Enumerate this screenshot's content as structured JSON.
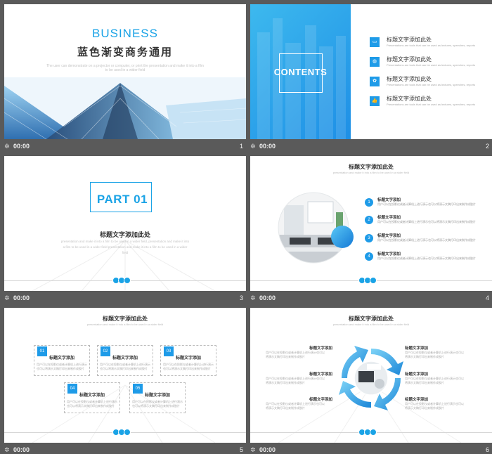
{
  "slides": [
    {
      "num": "1",
      "time": "00:00",
      "title": "BUSINESS",
      "subtitle": "蓝色渐变商务通用",
      "desc": "The user can demonstrate on a projector or computer, or print the presentation and make it into a film to be used in a wider field"
    },
    {
      "num": "2",
      "time": "00:00",
      "title": "CONTENTS",
      "items": [
        {
          "label": "标题文字添加此处",
          "small": "Presentations are tools that can be used as lectures, speeches, reports",
          "icon": "▭"
        },
        {
          "label": "标题文字添加此处",
          "small": "Presentations are tools that can be used as lectures, speeches, reports",
          "icon": "◍"
        },
        {
          "label": "标题文字添加此处",
          "small": "Presentations are tools that can be used as lectures, speeches, reports",
          "icon": "✿"
        },
        {
          "label": "标题文字添加此处",
          "small": "Presentations are tools that can be used as lectures, speeches, reports",
          "icon": "👍"
        }
      ]
    },
    {
      "num": "3",
      "time": "00:00",
      "title": "PART 01",
      "subtitle": "标题文字添加此处",
      "desc": "presentation and make it into a film to be used in a wider field, presentation and make it into a film to be used in a wider field presentation and make it into a film to be used in a wider field"
    },
    {
      "num": "4",
      "time": "00:00",
      "title": "标题文字添加此处",
      "subtitle": "presentation and make it into a film to be used in a wider field",
      "items": [
        {
          "n": "1",
          "title": "标题文字添加",
          "desc": "用户可以在投影仪或者计算机上进行演示也可以将演示文稿打印出来制作成胶片"
        },
        {
          "n": "2",
          "title": "标题文字添加",
          "desc": "用户可以在投影仪或者计算机上进行演示也可以将演示文稿打印出来制作成胶片"
        },
        {
          "n": "3",
          "title": "标题文字添加",
          "desc": "用户可以在投影仪或者计算机上进行演示也可以将演示文稿打印出来制作成胶片"
        },
        {
          "n": "4",
          "title": "标题文字添加",
          "desc": "用户可以在投影仪或者计算机上进行演示也可以将演示文稿打印出来制作成胶片"
        }
      ]
    },
    {
      "num": "5",
      "time": "00:00",
      "title": "标题文字添加此处",
      "subtitle": "presentation and make it into a film to be used in a wider field",
      "cards": [
        {
          "n": "01",
          "title": "标题文字添加",
          "desc": "用户可以在投影仪或者计算机上进行演示也可以将演示文稿打印出来制作成胶片"
        },
        {
          "n": "02",
          "title": "标题文字添加",
          "desc": "用户可以在投影仪或者计算机上进行演示也可以将演示文稿打印出来制作成胶片"
        },
        {
          "n": "03",
          "title": "标题文字添加",
          "desc": "用户可以在投影仪或者计算机上进行演示也可以将演示文稿打印出来制作成胶片"
        },
        {
          "n": "04",
          "title": "标题文字添加",
          "desc": "用户可以在投影仪或者计算机上进行演示也可以将演示文稿打印出来制作成胶片"
        },
        {
          "n": "05",
          "title": "标题文字添加",
          "desc": "用户可以在投影仪或者计算机上进行演示也可以将演示文稿打印出来制作成胶片"
        }
      ]
    },
    {
      "num": "6",
      "time": "00:00",
      "title": "标题文字添加此处",
      "subtitle": "presentation and make it into a film to be used in a wider field",
      "items": [
        {
          "title": "标题文字添加",
          "desc": "用户可以在投影仪或者计算机上进行演示也可以将演示文稿打印出来制作成胶片"
        },
        {
          "title": "标题文字添加",
          "desc": "用户可以在投影仪或者计算机上进行演示也可以将演示文稿打印出来制作成胶片"
        },
        {
          "title": "标题文字添加",
          "desc": "用户可以在投影仪或者计算机上进行演示也可以将演示文稿打印出来制作成胶片"
        },
        {
          "title": "标题文字添加",
          "desc": "用户可以在投影仪或者计算机上进行演示也可以将演示文稿打印出来制作成胶片"
        },
        {
          "title": "标题文字添加",
          "desc": "用户可以在投影仪或者计算机上进行演示也可以将演示文稿打印出来制作成胶片"
        },
        {
          "title": "标题文字添加",
          "desc": "用户可以在投影仪或者计算机上进行演示也可以将演示文稿打印出来制作成胶片"
        }
      ]
    }
  ],
  "colors": {
    "accent": "#1aa3e6",
    "background": "#5a5a5a",
    "slide": "#ffffff"
  },
  "icons": {
    "transition": "star-icon"
  }
}
